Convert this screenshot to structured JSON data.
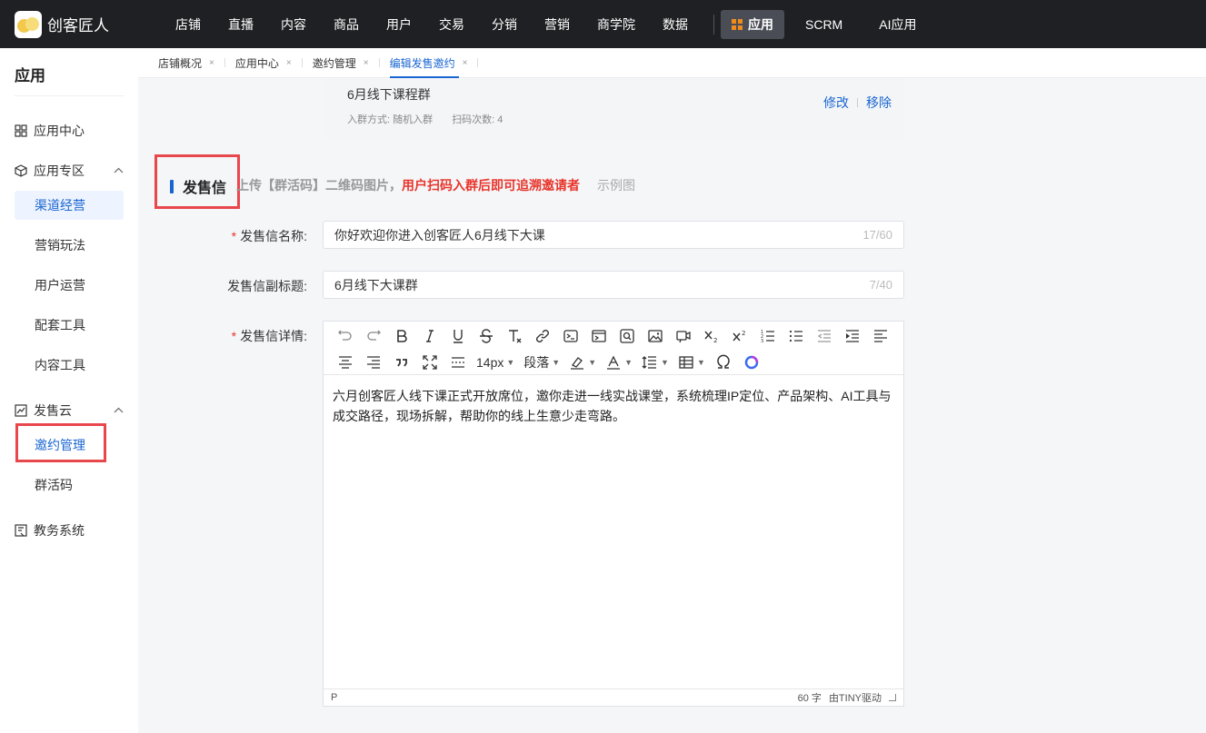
{
  "app": {
    "brand": "创客匠人"
  },
  "nav": {
    "items": [
      "店铺",
      "直播",
      "内容",
      "商品",
      "用户",
      "交易",
      "分销",
      "营销",
      "商学院",
      "数据"
    ],
    "active": "应用",
    "after": [
      "SCRM",
      "AI应用"
    ]
  },
  "sidebar": {
    "title": "应用",
    "app_center": "应用中心",
    "app_zone": "应用专区",
    "channel_ops": "渠道经营",
    "marketing": "营销玩法",
    "user_ops": "用户运营",
    "tools": "配套工具",
    "content_tools": "内容工具",
    "sales_cloud": "发售云",
    "invite_mgmt": "邀约管理",
    "group_code": "群活码",
    "edu_system": "教务系统"
  },
  "tabs": [
    {
      "label": "店铺概况",
      "close": "×"
    },
    {
      "label": "应用中心",
      "close": "×"
    },
    {
      "label": "邀约管理",
      "close": "×"
    },
    {
      "label": "编辑发售邀约",
      "close": "×"
    }
  ],
  "group_card": {
    "name": "6月线下课程群",
    "join_method": "入群方式: 随机入群",
    "scan_count": "扫码次数: 4",
    "edit": "修改",
    "remove": "移除"
  },
  "section": {
    "title": "发售信",
    "hint_prefix": "上传【群活码】二维码图片，",
    "hint_red": "用户扫码入群后即可追溯邀请者",
    "example": "示例图"
  },
  "form": {
    "name_label": "发售信名称:",
    "name_value": "你好欢迎你进入创客匠人6月线下大课",
    "name_count": "17/60",
    "subtitle_label": "发售信副标题:",
    "subtitle_value": "6月线下大课群",
    "subtitle_count": "7/40",
    "detail_label": "发售信详情:",
    "required_mark": "*"
  },
  "editor": {
    "font_size": "14px",
    "block_format": "段落",
    "content": "六月创客匠人线下课正式开放席位，邀你走进一线实战课堂，系统梳理IP定位、产品架构、AI工具与成交路径，现场拆解，帮助你的线上生意少走弯路。",
    "status_path": "P",
    "word_count": "60 字",
    "powered": "由TINY驱动"
  },
  "colors": {
    "accent": "#1a66d1",
    "required": "#e8352b",
    "highlight_box": "#e8474c",
    "topbar": "#1f2023"
  }
}
